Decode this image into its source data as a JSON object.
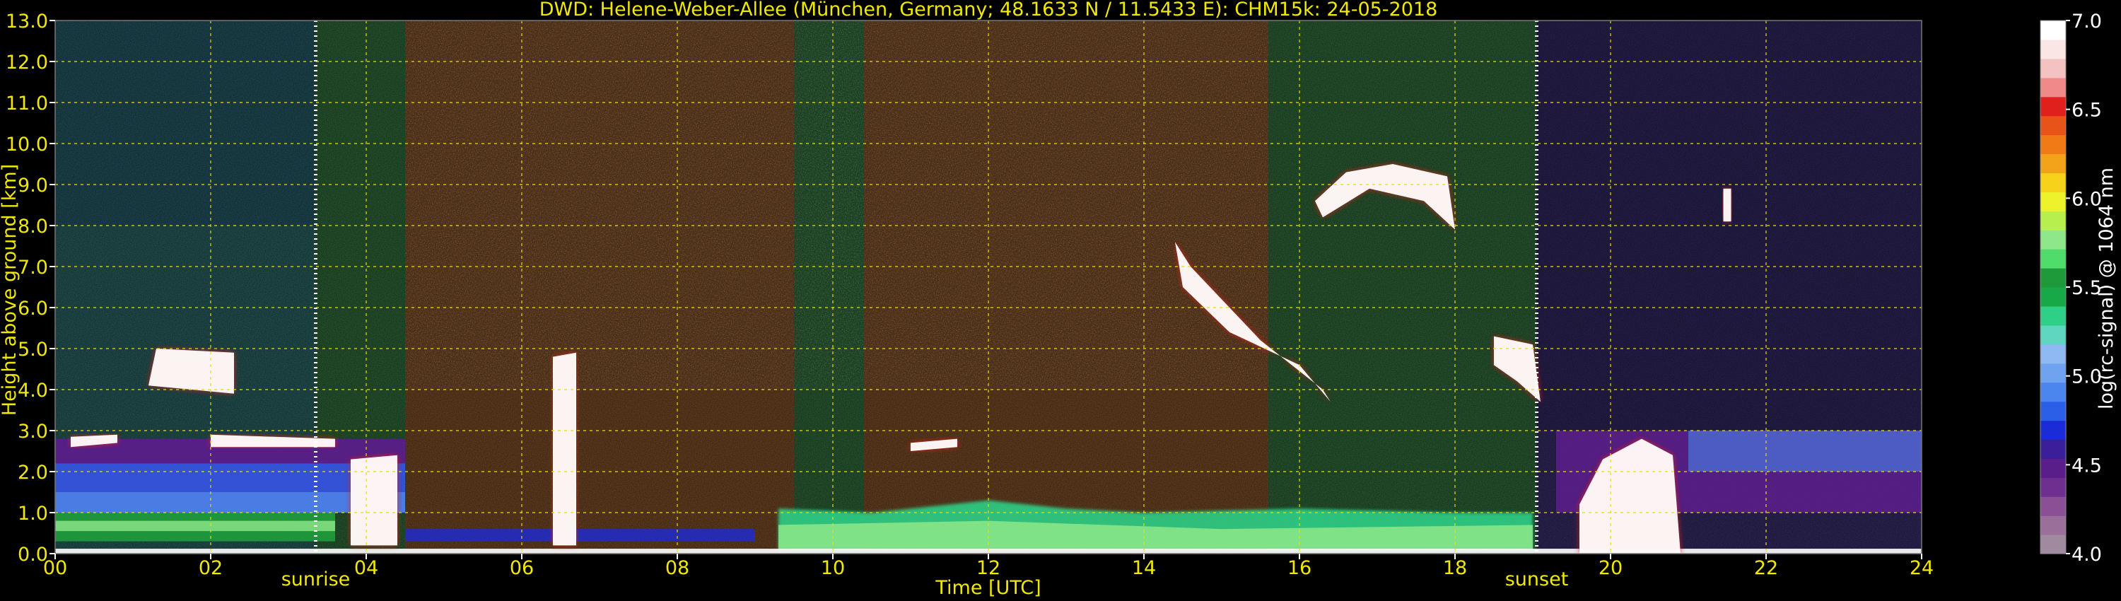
{
  "chart_data": {
    "type": "heatmap",
    "title": "DWD: Helene-Weber-Allee (München, Germany; 48.1633 N / 11.5433 E):    CHM15k: 24-05-2018",
    "xlabel": "Time [UTC]",
    "ylabel": "Height above ground [km]",
    "xlim": [
      0,
      24
    ],
    "ylim": [
      0,
      13
    ],
    "x_ticks": [
      "00",
      "02",
      "04",
      "06",
      "08",
      "10",
      "12",
      "14",
      "16",
      "18",
      "20",
      "22",
      "24"
    ],
    "y_ticks": [
      "0.0",
      "1.0",
      "2.0",
      "3.0",
      "4.0",
      "5.0",
      "6.0",
      "7.0",
      "8.0",
      "9.0",
      "10.0",
      "11.0",
      "12.0",
      "13.0"
    ],
    "grid": true,
    "markers": [
      {
        "label": "sunrise",
        "x": 3.35
      },
      {
        "label": "sunset",
        "x": 19.05
      }
    ],
    "colorbar": {
      "label": "log(rc-signal) @ 1064 nm",
      "range": [
        4.0,
        7.0
      ],
      "ticks": [
        "4.0",
        "4.5",
        "5.0",
        "5.5",
        "6.0",
        "6.5",
        "7.0"
      ],
      "colors": [
        "#a08aa0",
        "#9a6f9a",
        "#8a4f95",
        "#6f2f90",
        "#5a1e8a",
        "#3a1e9a",
        "#1b2bd8",
        "#2b5fe8",
        "#4a86ee",
        "#6fa3f0",
        "#8fb9f2",
        "#5fd6c0",
        "#2ecf86",
        "#17a848",
        "#1f9a3a",
        "#4fdc6a",
        "#8ee88a",
        "#b7ef4e",
        "#eef22a",
        "#f7d21a",
        "#f3a31a",
        "#ef7a16",
        "#e8531a",
        "#e0201c",
        "#f08a8a",
        "#f5c2c2",
        "#fbe6e6",
        "#ffffff"
      ]
    },
    "background_colors": {
      "black": "#000000",
      "green": "#244f2c",
      "brown": "#5c3a1e",
      "purple": "#2a2250",
      "teal": "#1f4a4a"
    },
    "features": [
      {
        "name": "boundary layer",
        "x_range": [
          0,
          24
        ],
        "height_km": [
          0.0,
          1.0
        ]
      },
      {
        "name": "residual layer",
        "x_range": [
          0,
          4.5
        ],
        "height_km": [
          1.0,
          2.8
        ]
      },
      {
        "name": "cloud",
        "x_range": [
          0.2,
          0.8
        ],
        "height_km": [
          2.6,
          2.9
        ]
      },
      {
        "name": "cloud",
        "x_range": [
          1.2,
          2.3
        ],
        "height_km": [
          3.8,
          5.0
        ]
      },
      {
        "name": "cloud",
        "x_range": [
          3.8,
          4.5
        ],
        "height_km": [
          0.1,
          2.5
        ]
      },
      {
        "name": "cloud",
        "x_range": [
          6.4,
          6.7
        ],
        "height_km": [
          0.1,
          5.0
        ]
      },
      {
        "name": "cloud",
        "x_range": [
          14.4,
          16.4
        ],
        "height_km": [
          3.7,
          7.6
        ]
      },
      {
        "name": "cloud",
        "x_range": [
          16.2,
          18.0
        ],
        "height_km": [
          7.8,
          9.6
        ]
      },
      {
        "name": "cloud",
        "x_range": [
          18.5,
          19.1
        ],
        "height_km": [
          3.6,
          5.4
        ]
      },
      {
        "name": "cloud",
        "x_range": [
          19.6,
          20.9
        ],
        "height_km": [
          0.0,
          2.8
        ]
      },
      {
        "name": "cloud",
        "x_range": [
          21.4,
          21.6
        ],
        "height_km": [
          8.0,
          9.0
        ]
      }
    ]
  }
}
